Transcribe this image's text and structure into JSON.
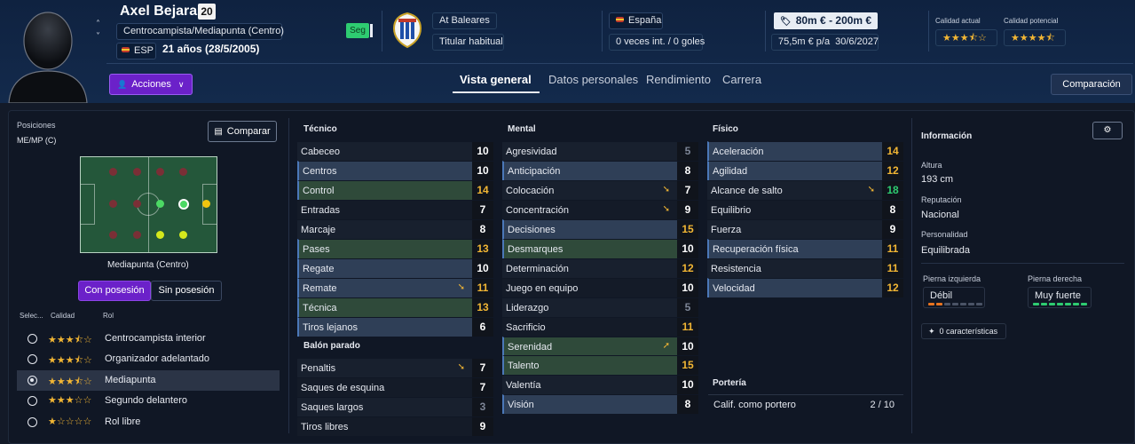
{
  "header": {
    "player_name": "Axel Bejarano",
    "shirt_number": "20",
    "position_text": "Centrocampista/Mediapunta (Centro)",
    "nation_code": "ESP",
    "age_text": "21 años (28/5/2005)",
    "status_tag": "Seg",
    "club_name": "At Baleares",
    "squad_status": "Titular habitual",
    "nationality": "España",
    "caps_text": "0 veces int. / 0 goles",
    "value_range": "80m € - 200m €",
    "wage_text": "75,5m € p/a",
    "contract_end": "30/6/2027",
    "current_ability_label": "Calidad actual",
    "potential_ability_label": "Calidad potencial",
    "current_ability_stars": 3.5,
    "potential_ability_stars": 4.5,
    "actions_label": "Acciones",
    "compare_button": "Comparación",
    "tabs": [
      "Vista general",
      "Datos personales",
      "Rendimiento",
      "Carrera"
    ],
    "active_tab": "Vista general"
  },
  "left": {
    "positions_label": "Posiciones",
    "positions_value": "ME/MP (C)",
    "compare_button": "Comparar",
    "position_caption": "Mediapunta (Centro)",
    "toggle_with": "Con posesión",
    "toggle_without": "Sin posesión",
    "roles_headers": {
      "select": "Selec...",
      "quality": "Calidad",
      "role": "Rol"
    },
    "roles": [
      {
        "name": "Centrocampista interior",
        "stars": 3.5,
        "selected": false
      },
      {
        "name": "Organizador adelantado",
        "stars": 3.5,
        "selected": false
      },
      {
        "name": "Mediapunta",
        "stars": 3.5,
        "selected": true
      },
      {
        "name": "Segundo delantero",
        "stars": 3,
        "selected": false
      },
      {
        "name": "Rol libre",
        "stars": 1,
        "selected": false
      }
    ]
  },
  "tecnico": {
    "title": "Técnico",
    "rows": [
      {
        "name": "Cabeceo",
        "value": "10"
      },
      {
        "name": "Centros",
        "value": "10"
      },
      {
        "name": "Control",
        "value": "14"
      },
      {
        "name": "Entradas",
        "value": "7"
      },
      {
        "name": "Marcaje",
        "value": "8"
      },
      {
        "name": "Pases",
        "value": "13"
      },
      {
        "name": "Regate",
        "value": "10"
      },
      {
        "name": "Remate",
        "value": "11"
      },
      {
        "name": "Técnica",
        "value": "13"
      },
      {
        "name": "Tiros lejanos",
        "value": "6"
      }
    ]
  },
  "balon_parado": {
    "title": "Balón parado",
    "rows": [
      {
        "name": "Penaltis",
        "value": "7"
      },
      {
        "name": "Saques de esquina",
        "value": "7"
      },
      {
        "name": "Saques largos",
        "value": "3"
      },
      {
        "name": "Tiros libres",
        "value": "9"
      }
    ]
  },
  "mental": {
    "title": "Mental",
    "rows": [
      {
        "name": "Agresividad",
        "value": "5"
      },
      {
        "name": "Anticipación",
        "value": "8"
      },
      {
        "name": "Colocación",
        "value": "7"
      },
      {
        "name": "Concentración",
        "value": "9"
      },
      {
        "name": "Decisiones",
        "value": "15"
      },
      {
        "name": "Desmarques",
        "value": "10"
      },
      {
        "name": "Determinación",
        "value": "12"
      },
      {
        "name": "Juego en equipo",
        "value": "10"
      },
      {
        "name": "Liderazgo",
        "value": "5"
      },
      {
        "name": "Sacrificio",
        "value": "11"
      },
      {
        "name": "Serenidad",
        "value": "10"
      },
      {
        "name": "Talento",
        "value": "15"
      },
      {
        "name": "Valentía",
        "value": "10"
      },
      {
        "name": "Visión",
        "value": "8"
      }
    ]
  },
  "fisico": {
    "title": "Físico",
    "rows": [
      {
        "name": "Aceleración",
        "value": "14"
      },
      {
        "name": "Agilidad",
        "value": "12"
      },
      {
        "name": "Alcance de salto",
        "value": "18"
      },
      {
        "name": "Equilibrio",
        "value": "8"
      },
      {
        "name": "Fuerza",
        "value": "9"
      },
      {
        "name": "Recuperación física",
        "value": "11"
      },
      {
        "name": "Resistencia",
        "value": "11"
      },
      {
        "name": "Velocidad",
        "value": "12"
      }
    ]
  },
  "porteria": {
    "title": "Portería",
    "row_name": "Calif. como portero",
    "row_value": "2 / 10"
  },
  "info": {
    "title": "Información",
    "height_label": "Altura",
    "height_value": "193 cm",
    "reputation_label": "Reputación",
    "reputation_value": "Nacional",
    "personality_label": "Personalidad",
    "personality_value": "Equilibrada",
    "left_foot_label": "Pierna izquierda",
    "left_foot_value": "Débil",
    "right_foot_label": "Pierna derecha",
    "right_foot_value": "Muy fuerte",
    "traits_button": "0 características"
  },
  "colors": {
    "accent_purple": "#6b21c9",
    "star_gold": "#f2b634",
    "green": "#2ecc71",
    "orange": "#e8731f"
  }
}
